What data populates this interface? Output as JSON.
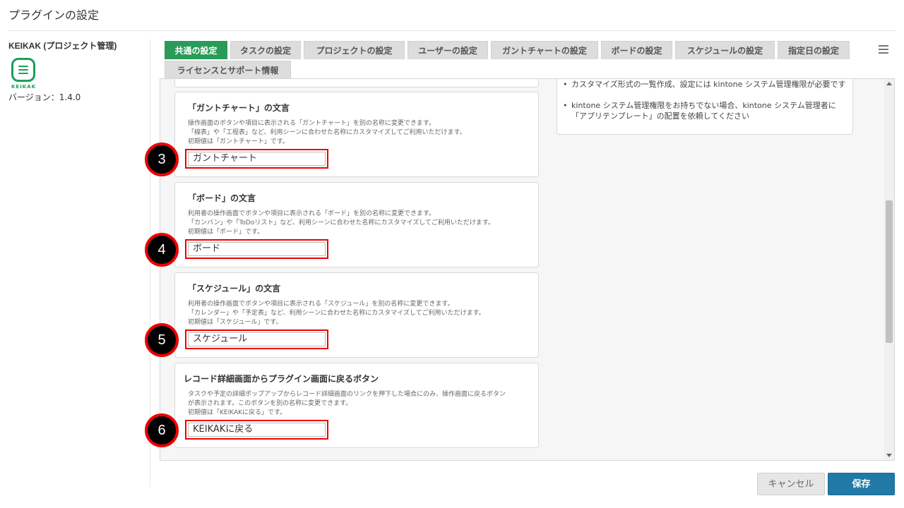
{
  "page_title": "プラグインの設定",
  "sidebar": {
    "plugin_name": "KEIKAK (プロジェクト管理)",
    "logo_text": "KEIKAK",
    "version": "バージョン：1.4.0"
  },
  "tabs": [
    {
      "label": "共通の設定",
      "active": true
    },
    {
      "label": "タスクの設定"
    },
    {
      "label": "プロジェクトの設定"
    },
    {
      "label": "ユーザーの設定"
    },
    {
      "label": "ガントチャートの設定"
    },
    {
      "label": "ボードの設定"
    },
    {
      "label": "スケジュールの設定"
    },
    {
      "label": "指定日の設定"
    },
    {
      "label": "ライセンスとサポート情報"
    }
  ],
  "notes": [
    "カスタマイズ形式の一覧作成、設定には kintone システム管理権限が必要です",
    "kintone システム管理権限をお持ちでない場合、kintone システム管理者に「アプリテンプレート」の配置を依頼してください"
  ],
  "cards": [
    {
      "title": "「ガントチャート」の文言",
      "desc": "操作画面のボタンや項目に表示される「ガントチャート」を別の名称に変更できます。\n「線表」や「工程表」など、利用シーンに合わせた名称にカスタマイズしてご利用いただけます。\n初期値は「ガントチャート」です。",
      "value": "ガントチャート",
      "marker": "3"
    },
    {
      "title": "「ボード」の文言",
      "desc": "利用者の操作画面でボタンや項目に表示される「ボード」を別の名称に変更できます。\n「カンバン」や「ToDoリスト」など、利用シーンに合わせた名称にカスタマイズしてご利用いただけます。\n初期値は「ボード」です。",
      "value": "ボード",
      "marker": "4"
    },
    {
      "title": "「スケジュール」の文言",
      "desc": "利用者の操作画面でボタンや項目に表示される「スケジュール」を別の名称に変更できます。\n「カレンダー」や「予定表」など、利用シーンに合わせた名称にカスタマイズしてご利用いただけます。\n初期値は「スケジュール」です。",
      "value": "スケジュール",
      "marker": "5"
    },
    {
      "title": "レコード詳細画面からプラグイン画面に戻るボタン",
      "desc": "タスクや予定の詳細ポップアップからレコード詳細画面のリンクを押下した場合にのみ、操作画面に戻るボタン\nが表示されます。このボタンを別の名称に変更できます。\n初期値は「KEIKAKに戻る」です。",
      "value": "KEIKAKに戻る",
      "marker": "6"
    }
  ],
  "buttons": {
    "cancel": "キャンセル",
    "save": "保存"
  },
  "colors": {
    "active_tab": "#2a9b58",
    "save_button": "#2079a6",
    "highlight": "#ee0000"
  }
}
